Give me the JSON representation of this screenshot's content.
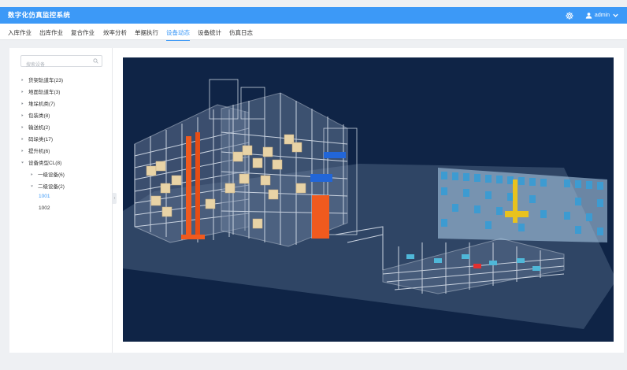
{
  "app": {
    "title": "数字化仿真监控系统",
    "user": "admin"
  },
  "icons": {
    "settings": "gear-icon",
    "user": "user-icon",
    "dropdown": "chevron-down-icon",
    "search": "search-icon",
    "expand": "caret-right-icon"
  },
  "colors": {
    "accent": "#3c99f7",
    "scene_bg": "#0f2446",
    "rack_orange": "#f05a1e",
    "rack_blue": "#2266d8"
  },
  "nav": [
    {
      "label": "入库作业"
    },
    {
      "label": "出库作业"
    },
    {
      "label": "复合作业"
    },
    {
      "label": "效率分析"
    },
    {
      "label": "单据执行"
    },
    {
      "label": "设备动态",
      "active": true
    },
    {
      "label": "设备统计"
    },
    {
      "label": "仿真日志"
    }
  ],
  "sidebar": {
    "search_placeholder": "搜索设备",
    "tree": [
      {
        "label": "货架轨道车(23)"
      },
      {
        "label": "地面轨道车(3)"
      },
      {
        "label": "堆垛机类(7)"
      },
      {
        "label": "包装类(8)"
      },
      {
        "label": "输送机(2)"
      },
      {
        "label": "码垛类(17)"
      },
      {
        "label": "提升机(6)"
      },
      {
        "label": "设备类型CL(8)",
        "expanded": true
      },
      {
        "label": "一级设备(6)"
      },
      {
        "label": "二级设备(2)",
        "expanded": true
      },
      {
        "label": "1001",
        "selected": true
      },
      {
        "label": "1002"
      }
    ]
  }
}
